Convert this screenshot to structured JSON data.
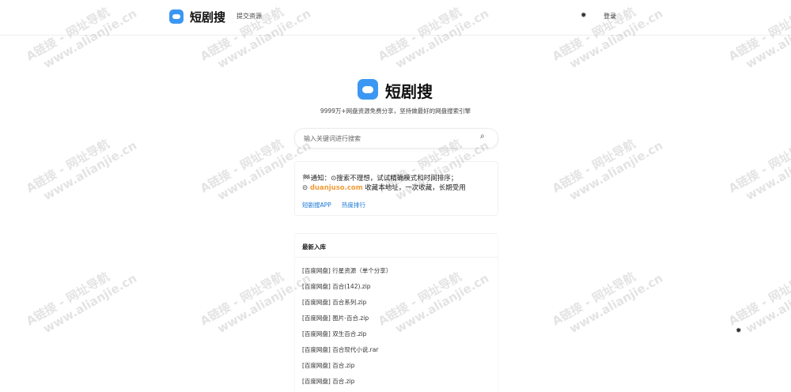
{
  "header": {
    "brand": "短剧搜",
    "nav_submit": "提交资源",
    "theme_icon_glyph": "✹",
    "login": "登录"
  },
  "hero": {
    "title": "短剧搜",
    "subtitle": "9999万+网盘资源免费分享，坚持做最好的网盘搜索引擎"
  },
  "search": {
    "placeholder": "输入关键词进行搜索",
    "icon_glyph": "⌕"
  },
  "notice": {
    "line1": "🏁通知：⊙搜索不理想，试试精确模式和时间排序；",
    "line2_prefix": "⊙ ",
    "domain": "duanjuso.com",
    "line2_suffix": " 收藏本地址，一次收藏，长期受用",
    "links": [
      "短剧搜APP",
      "热度排行"
    ]
  },
  "latest": {
    "title": "最新入库",
    "items": [
      "[百度网盘] 行星资源（单个分享）",
      "[百度网盘] 百合(142).zip",
      "[百度网盘] 百合系列.zip",
      "[百度网盘] 图片-百合.zip",
      "[百度网盘] 双生百合.zip",
      "[百度网盘] 百合现代小说.rar",
      "[百度网盘] 百合.zip",
      "[百度网盘] 百合.zip"
    ]
  },
  "side_icon_glyph": "✹",
  "watermark": {
    "line1": "A链接 - 网址导航",
    "line2": "www.alianjie.cn"
  },
  "colors": {
    "accent": "#3b97f3",
    "link": "#1677d6",
    "domain": "#f29c38"
  }
}
